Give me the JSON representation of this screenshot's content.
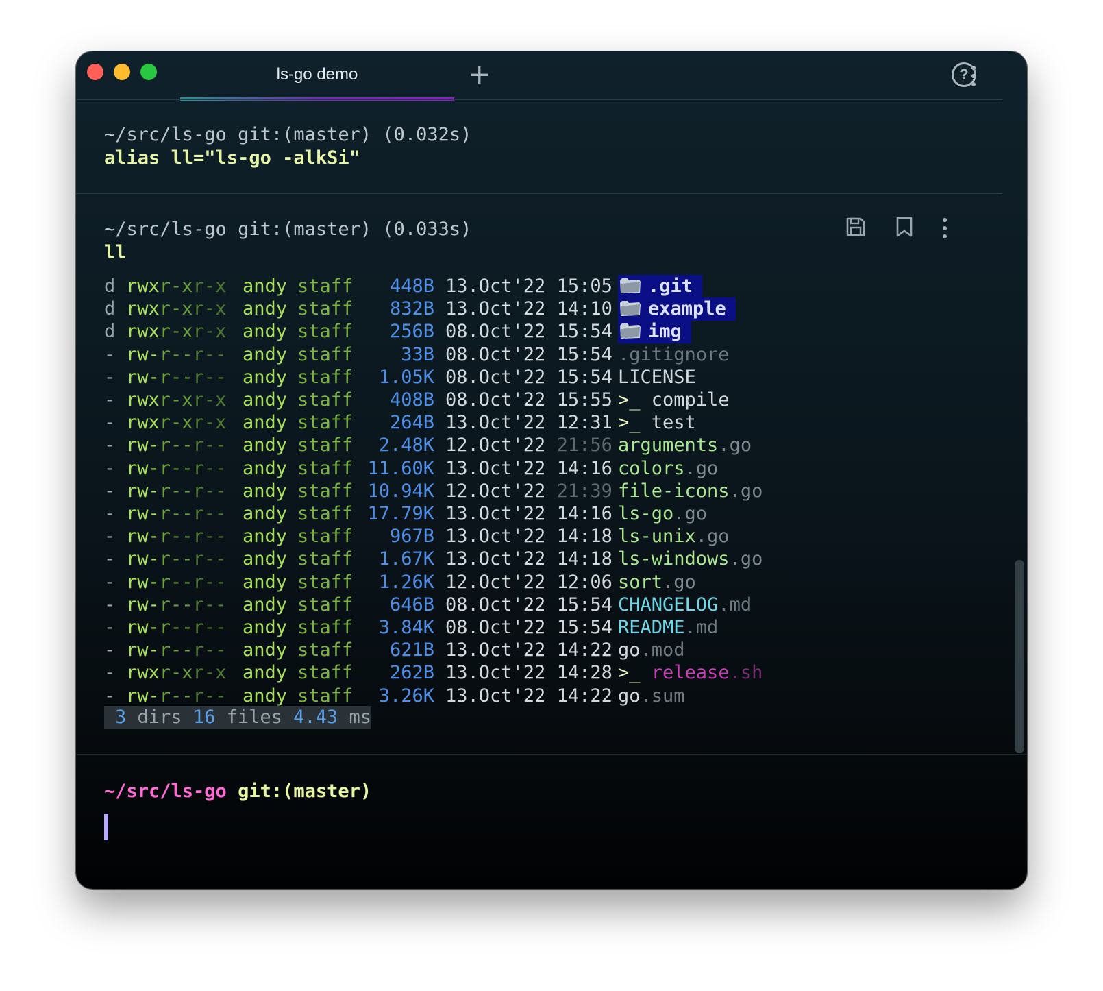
{
  "window": {
    "tab_title": "ls-go demo",
    "new_tab_symbol": "+",
    "help_symbol": "?",
    "traffic_lights": [
      "#ff5f57",
      "#febc2e",
      "#28c840"
    ]
  },
  "blocks": [
    {
      "prompt": "~/src/ls-go git:(master) (0.032s)",
      "command": "alias ll=\"ls-go -alkSi\""
    },
    {
      "prompt": "~/src/ls-go git:(master) (0.033s)",
      "command": "ll"
    }
  ],
  "block_actions": [
    "save-icon",
    "bookmark-icon",
    "more-vert-icon"
  ],
  "listing": [
    {
      "type": "d",
      "perm": [
        "rwx",
        "r-x",
        "r-x"
      ],
      "user": "andy",
      "group": "staff",
      "size": "448B",
      "date": "13.Oct'22",
      "time": "15:05",
      "time_dim": false,
      "name": ".git",
      "ext": "",
      "kind": "dir"
    },
    {
      "type": "d",
      "perm": [
        "rwx",
        "r-x",
        "r-x"
      ],
      "user": "andy",
      "group": "staff",
      "size": "832B",
      "date": "13.Oct'22",
      "time": "14:10",
      "time_dim": false,
      "name": "example",
      "ext": "",
      "kind": "dir"
    },
    {
      "type": "d",
      "perm": [
        "rwx",
        "r-x",
        "r-x"
      ],
      "user": "andy",
      "group": "staff",
      "size": "256B",
      "date": "08.Oct'22",
      "time": "15:54",
      "time_dim": false,
      "name": "img",
      "ext": "",
      "kind": "dir"
    },
    {
      "type": "-",
      "perm": [
        "rw-",
        "r--",
        "r--"
      ],
      "user": "andy",
      "group": "staff",
      "size": "33B",
      "date": "08.Oct'22",
      "time": "15:54",
      "time_dim": false,
      "name": ".gitignore",
      "ext": "",
      "kind": "hidden"
    },
    {
      "type": "-",
      "perm": [
        "rw-",
        "r--",
        "r--"
      ],
      "user": "andy",
      "group": "staff",
      "size": "1.05K",
      "date": "08.Oct'22",
      "time": "15:54",
      "time_dim": false,
      "name": "LICENSE",
      "ext": "",
      "kind": "plain"
    },
    {
      "type": "-",
      "perm": [
        "rwx",
        "r-x",
        "r-x"
      ],
      "user": "andy",
      "group": "staff",
      "size": "408B",
      "date": "08.Oct'22",
      "time": "15:55",
      "time_dim": false,
      "name": "compile",
      "ext": "",
      "kind": "exec"
    },
    {
      "type": "-",
      "perm": [
        "rwx",
        "r-x",
        "r-x"
      ],
      "user": "andy",
      "group": "staff",
      "size": "264B",
      "date": "13.Oct'22",
      "time": "12:31",
      "time_dim": false,
      "name": "test",
      "ext": "",
      "kind": "exec"
    },
    {
      "type": "-",
      "perm": [
        "rw-",
        "r--",
        "r--"
      ],
      "user": "andy",
      "group": "staff",
      "size": "2.48K",
      "date": "12.Oct'22",
      "time": "21:56",
      "time_dim": true,
      "name": "arguments",
      "ext": ".go",
      "kind": "go"
    },
    {
      "type": "-",
      "perm": [
        "rw-",
        "r--",
        "r--"
      ],
      "user": "andy",
      "group": "staff",
      "size": "11.60K",
      "date": "13.Oct'22",
      "time": "14:16",
      "time_dim": false,
      "name": "colors",
      "ext": ".go",
      "kind": "go"
    },
    {
      "type": "-",
      "perm": [
        "rw-",
        "r--",
        "r--"
      ],
      "user": "andy",
      "group": "staff",
      "size": "10.94K",
      "date": "12.Oct'22",
      "time": "21:39",
      "time_dim": true,
      "name": "file-icons",
      "ext": ".go",
      "kind": "go"
    },
    {
      "type": "-",
      "perm": [
        "rw-",
        "r--",
        "r--"
      ],
      "user": "andy",
      "group": "staff",
      "size": "17.79K",
      "date": "13.Oct'22",
      "time": "14:16",
      "time_dim": false,
      "name": "ls-go",
      "ext": ".go",
      "kind": "go"
    },
    {
      "type": "-",
      "perm": [
        "rw-",
        "r--",
        "r--"
      ],
      "user": "andy",
      "group": "staff",
      "size": "967B",
      "date": "13.Oct'22",
      "time": "14:18",
      "time_dim": false,
      "name": "ls-unix",
      "ext": ".go",
      "kind": "go"
    },
    {
      "type": "-",
      "perm": [
        "rw-",
        "r--",
        "r--"
      ],
      "user": "andy",
      "group": "staff",
      "size": "1.67K",
      "date": "13.Oct'22",
      "time": "14:18",
      "time_dim": false,
      "name": "ls-windows",
      "ext": ".go",
      "kind": "go"
    },
    {
      "type": "-",
      "perm": [
        "rw-",
        "r--",
        "r--"
      ],
      "user": "andy",
      "group": "staff",
      "size": "1.26K",
      "date": "12.Oct'22",
      "time": "12:06",
      "time_dim": false,
      "name": "sort",
      "ext": ".go",
      "kind": "go"
    },
    {
      "type": "-",
      "perm": [
        "rw-",
        "r--",
        "r--"
      ],
      "user": "andy",
      "group": "staff",
      "size": "646B",
      "date": "08.Oct'22",
      "time": "15:54",
      "time_dim": false,
      "name": "CHANGELOG",
      "ext": ".md",
      "kind": "md"
    },
    {
      "type": "-",
      "perm": [
        "rw-",
        "r--",
        "r--"
      ],
      "user": "andy",
      "group": "staff",
      "size": "3.84K",
      "date": "08.Oct'22",
      "time": "15:54",
      "time_dim": false,
      "name": "README",
      "ext": ".md",
      "kind": "md"
    },
    {
      "type": "-",
      "perm": [
        "rw-",
        "r--",
        "r--"
      ],
      "user": "andy",
      "group": "staff",
      "size": "621B",
      "date": "13.Oct'22",
      "time": "14:22",
      "time_dim": false,
      "name": "go",
      "ext": ".mod",
      "kind": "plain"
    },
    {
      "type": "-",
      "perm": [
        "rwx",
        "r-x",
        "r-x"
      ],
      "user": "andy",
      "group": "staff",
      "size": "262B",
      "date": "13.Oct'22",
      "time": "14:28",
      "time_dim": false,
      "name": "release",
      "ext": ".sh",
      "kind": "sh"
    },
    {
      "type": "-",
      "perm": [
        "rw-",
        "r--",
        "r--"
      ],
      "user": "andy",
      "group": "staff",
      "size": "3.26K",
      "date": "13.Oct'22",
      "time": "14:22",
      "time_dim": false,
      "name": "go",
      "ext": ".sum",
      "kind": "plain"
    }
  ],
  "exec_prefix": ">_",
  "summary": {
    "dirs": "3",
    "dirs_label": "dirs",
    "files": "16",
    "files_label": "files",
    "time": "4.43",
    "time_unit": "ms"
  },
  "active_prompt": {
    "path": "~/src/ls-go",
    "git": "git:(master)"
  },
  "colors": {
    "dir_bg": "#0a0f86",
    "go_name": "#a9e890",
    "md_name": "#6fd6e6",
    "sh_name": "#c93fb7",
    "size": "#4e8fe8",
    "user": "#a8e05a",
    "group": "#7cb342"
  }
}
